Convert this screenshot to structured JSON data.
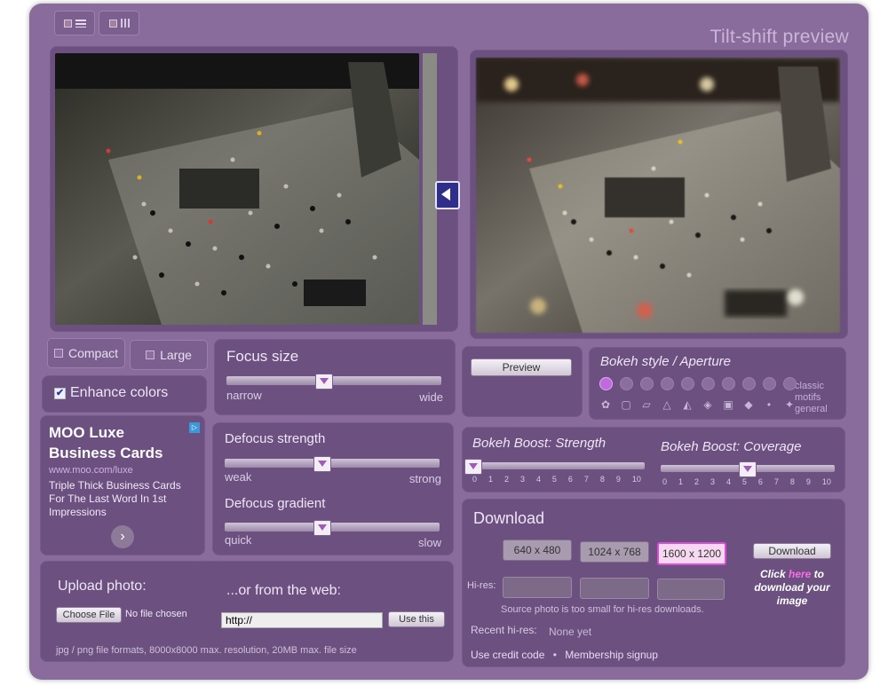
{
  "app_title": "Tilt-shift preview",
  "view_modes": [
    {
      "icons": [
        "view-square-icon",
        "list-icon"
      ]
    },
    {
      "icons": [
        "view-square-icon",
        "bars-icon"
      ]
    }
  ],
  "layout_buttons": {
    "compact": "Compact",
    "large": "Large"
  },
  "enhance_colors": {
    "label": "Enhance colors",
    "checked": true
  },
  "focus_size": {
    "label": "Focus size",
    "min_label": "narrow",
    "max_label": "wide",
    "value": 0.45
  },
  "defocus_strength": {
    "label": "Defocus strength",
    "min_label": "weak",
    "max_label": "strong",
    "value": 0.45
  },
  "defocus_gradient": {
    "label": "Defocus gradient",
    "min_label": "quick",
    "max_label": "slow",
    "value": 0.45
  },
  "ad": {
    "title_line1": "MOO Luxe",
    "title_line2": "Business Cards",
    "url": "www.moo.com/luxe",
    "body": "Triple Thick Business Cards For The Last Word In 1st Impressions",
    "badge": "▷"
  },
  "preview_button": "Preview",
  "bokeh": {
    "title": "Bokeh style / Aperture",
    "row_labels": [
      "classic",
      "motifs",
      "general"
    ]
  },
  "boost_strength": {
    "label": "Bokeh Boost: Strength",
    "value": 0,
    "ticks": [
      "0",
      "1",
      "2",
      "3",
      "4",
      "5",
      "6",
      "7",
      "8",
      "9",
      "10"
    ]
  },
  "boost_coverage": {
    "label": "Bokeh Boost: Coverage",
    "value": 5,
    "ticks": [
      "0",
      "1",
      "2",
      "3",
      "4",
      "5",
      "6",
      "7",
      "8",
      "9",
      "10"
    ]
  },
  "download": {
    "title": "Download",
    "sizes": [
      "640 x 480",
      "1024 x 768",
      "1600 x 1200"
    ],
    "selected_size": "1600 x 1200",
    "download_button": "Download",
    "cta_part1": "Click ",
    "cta_link": "here",
    "cta_part2": " to download your image",
    "hires_label": "Hi-res:",
    "hires_note": "Source photo is too small for hi-res downloads.",
    "recent_label": "Recent hi-res:",
    "recent_value": "None yet",
    "use_credit_link": "Use credit code",
    "separator": "•",
    "membership_link": "Membership signup"
  },
  "upload": {
    "title": "Upload photo:",
    "choose_file": "Choose File",
    "no_file": "No file chosen",
    "web_title": "...or from the web:",
    "url_value": "http://",
    "use_this": "Use this",
    "note": "jpg / png file formats, 8000x8000 max. resolution, 20MB max. file size"
  },
  "colors": {
    "frame": "#8a6c9c",
    "panel": "#6b5080",
    "accent": "#d84ed4"
  }
}
